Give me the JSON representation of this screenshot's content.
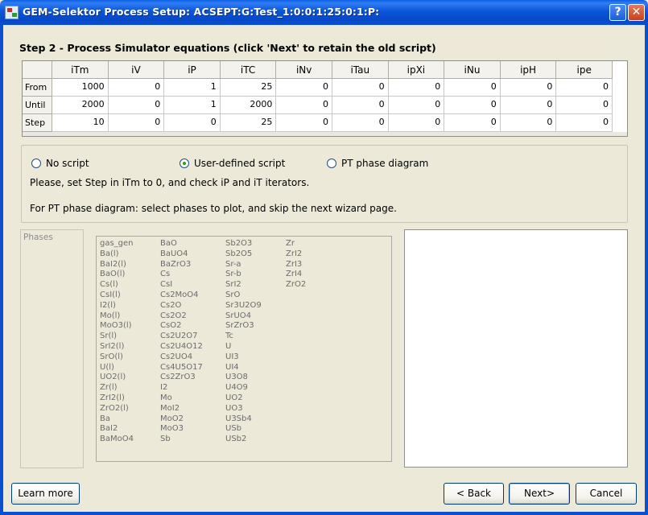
{
  "window": {
    "title": "GEM-Selektor Process Setup:  ACSEPT:G:Test_1:0:0:1:25:0:1:P:",
    "help_label": "?",
    "close_label": "✕"
  },
  "step_title": "Step 2 - Process Simulator equations (click 'Next' to retain the old script)",
  "grid": {
    "columns": [
      "iTm",
      "iV",
      "iP",
      "iTC",
      "iNv",
      "iTau",
      "ipXi",
      "iNu",
      "ipH",
      "ipe"
    ],
    "rows": [
      {
        "label": "From",
        "values": [
          "1000",
          "0",
          "1",
          "25",
          "0",
          "0",
          "0",
          "0",
          "0",
          "0"
        ]
      },
      {
        "label": "Until",
        "values": [
          "2000",
          "0",
          "1",
          "2000",
          "0",
          "0",
          "0",
          "0",
          "0",
          "0"
        ]
      },
      {
        "label": "Step",
        "values": [
          "10",
          "0",
          "0",
          "25",
          "0",
          "0",
          "0",
          "0",
          "0",
          "0"
        ]
      }
    ]
  },
  "options": {
    "radios": [
      {
        "label": "No script",
        "checked": false
      },
      {
        "label": "User-defined script",
        "checked": true
      },
      {
        "label": "PT phase diagram",
        "checked": false
      }
    ],
    "hint1": "Please, set Step in iTm to 0, and check iP and iT iterators.",
    "hint2": "For PT phase diagram: select phases to plot, and skip the next wizard page."
  },
  "phases": {
    "label": "Phases",
    "columns": [
      [
        "gas_gen",
        "Ba(l)",
        "BaI2(l)",
        "BaO(l)",
        "Cs(l)",
        "CsI(l)",
        "I2(l)",
        "Mo(l)",
        "MoO3(l)",
        "Sr(l)",
        "SrI2(l)",
        "SrO(l)",
        "U(l)",
        "UO2(l)",
        "Zr(l)",
        "ZrI2(l)",
        "ZrO2(l)",
        "Ba",
        "BaI2",
        "BaMoO4"
      ],
      [
        "BaO",
        "BaUO4",
        "BaZrO3",
        "Cs",
        "CsI",
        "Cs2MoO4",
        "Cs2O",
        "Cs2O2",
        "CsO2",
        "Cs2U2O7",
        "Cs2U4O12",
        "Cs2UO4",
        "Cs4U5O17",
        "Cs2ZrO3",
        "I2",
        "Mo",
        "MoI2",
        "MoO2",
        "MoO3",
        "Sb"
      ],
      [
        "Sb2O3",
        "Sb2O5",
        "Sr-a",
        "Sr-b",
        "SrI2",
        "SrO",
        "Sr3U2O9",
        "SrUO4",
        "SrZrO3",
        "Tc",
        "U",
        "UI3",
        "UI4",
        "U3O8",
        "U4O9",
        "UO2",
        "UO3",
        "U3Sb4",
        "USb",
        "USb2"
      ],
      [
        "Zr",
        "ZrI2",
        "ZrI3",
        "ZrI4",
        "ZrO2"
      ]
    ]
  },
  "buttons": {
    "learn_more": "Learn more",
    "back": "< Back",
    "next": "Next>",
    "cancel": "Cancel"
  },
  "colors": {
    "titlebar": "#0A56D8",
    "window_bg": "#ECE9D8",
    "selected_radio": "#21A121"
  }
}
